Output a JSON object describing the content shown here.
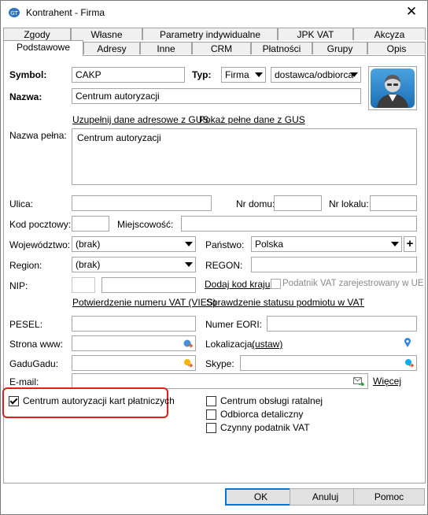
{
  "window": {
    "title": "Kontrahent - Firma"
  },
  "tabs_row1": [
    "Zgody",
    "Własne",
    "Parametry indywidualne",
    "JPK VAT",
    "Akcyza"
  ],
  "tabs_row2": [
    "Podstawowe",
    "Adresy",
    "Inne",
    "CRM",
    "Płatności",
    "Grupy",
    "Opis"
  ],
  "form": {
    "symbol_label": "Symbol:",
    "symbol_value": "CAKP",
    "typ_label": "Typ:",
    "typ_value": "Firma",
    "role_value": "dostawca/odbiorca",
    "nazwa_label": "Nazwa:",
    "nazwa_value": "Centrum autoryzacji",
    "gus_link": "Uzupełnij dane adresowe z GUS",
    "gus_full_link": "Pokaż pełne dane z GUS",
    "nazwa_pelna_label": "Nazwa pełna:",
    "nazwa_pelna_value": "Centrum autoryzacji",
    "ulica_label": "Ulica:",
    "nr_domu_label": "Nr domu:",
    "nr_lokalu_label": "Nr lokalu:",
    "kod_label": "Kod pocztowy:",
    "miejscowosc_label": "Miejscowość:",
    "wojewodztwo_label": "Województwo:",
    "wojewodztwo_value": "(brak)",
    "panstwo_label": "Państwo:",
    "panstwo_value": "Polska",
    "region_label": "Region:",
    "region_value": "(brak)",
    "regon_label": "REGON:",
    "nip_label": "NIP:",
    "dodaj_kod_link": "Dodaj kod kraju",
    "podatnik_vat_ue": "Podatnik VAT zarejestrowany w UE",
    "vies_link": "Potwierdzenie numeru VAT (VIES)",
    "status_vat_link": "Sprawdzenie statusu podmiotu w VAT",
    "pesel_label": "PESEL:",
    "eori_label": "Numer EORI:",
    "www_label": "Strona www:",
    "lokalizacja_label": "Lokalizacja:",
    "ustaw_link": "(ustaw)",
    "gadugadu_label": "GaduGadu:",
    "skype_label": "Skype:",
    "email_label": "E-mail:",
    "wiecej_link": "Więcej"
  },
  "checkboxes": {
    "cak": {
      "label": "Centrum autoryzacji kart płatniczych",
      "checked": true
    },
    "ratalnej": {
      "label": "Centrum obsługi ratalnej",
      "checked": false
    },
    "detaliczny": {
      "label": "Odbiorca detaliczny",
      "checked": false
    },
    "czynny_vat": {
      "label": "Czynny podatnik VAT",
      "checked": false
    }
  },
  "buttons": {
    "ok": "OK",
    "cancel": "Anuluj",
    "help": "Pomoc"
  },
  "colors": {
    "accent": "#0078d7",
    "highlight": "#e41c1c"
  }
}
